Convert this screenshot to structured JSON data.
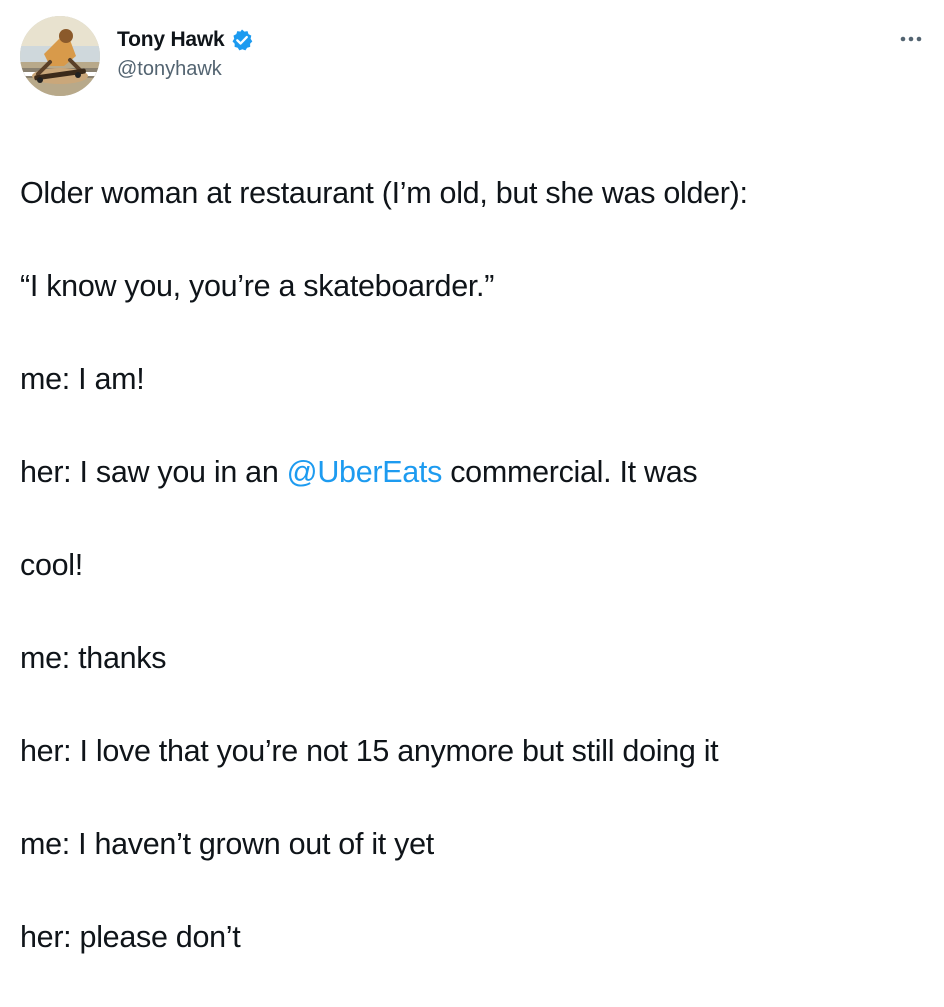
{
  "author": {
    "display_name": "Tony Hawk",
    "handle": "@tonyhawk",
    "verified": true
  },
  "icons": {
    "verified": "verified-badge-icon",
    "more": "more-options-icon",
    "avatar": "profile-photo-skateboarder"
  },
  "colors": {
    "text": "#0f1419",
    "secondary": "#536471",
    "link": "#1d9bf0",
    "verified": "#1d9bf0"
  },
  "tweet": {
    "line1": "Older woman at restaurant (I’m old, but she was older):",
    "line2": "“I know you, you’re a skateboarder.”",
    "line3": "me: I am!",
    "line4_before": "her: I saw you in an ",
    "line4_mention": "@UberEats",
    "line4_after": " commercial. It was",
    "line5": "cool!",
    "line6": "me: thanks",
    "line7": "her: I love that you’re not 15 anymore but still doing it",
    "line8": "me: I haven’t grown out of it yet",
    "line9": "her: please don’t"
  }
}
